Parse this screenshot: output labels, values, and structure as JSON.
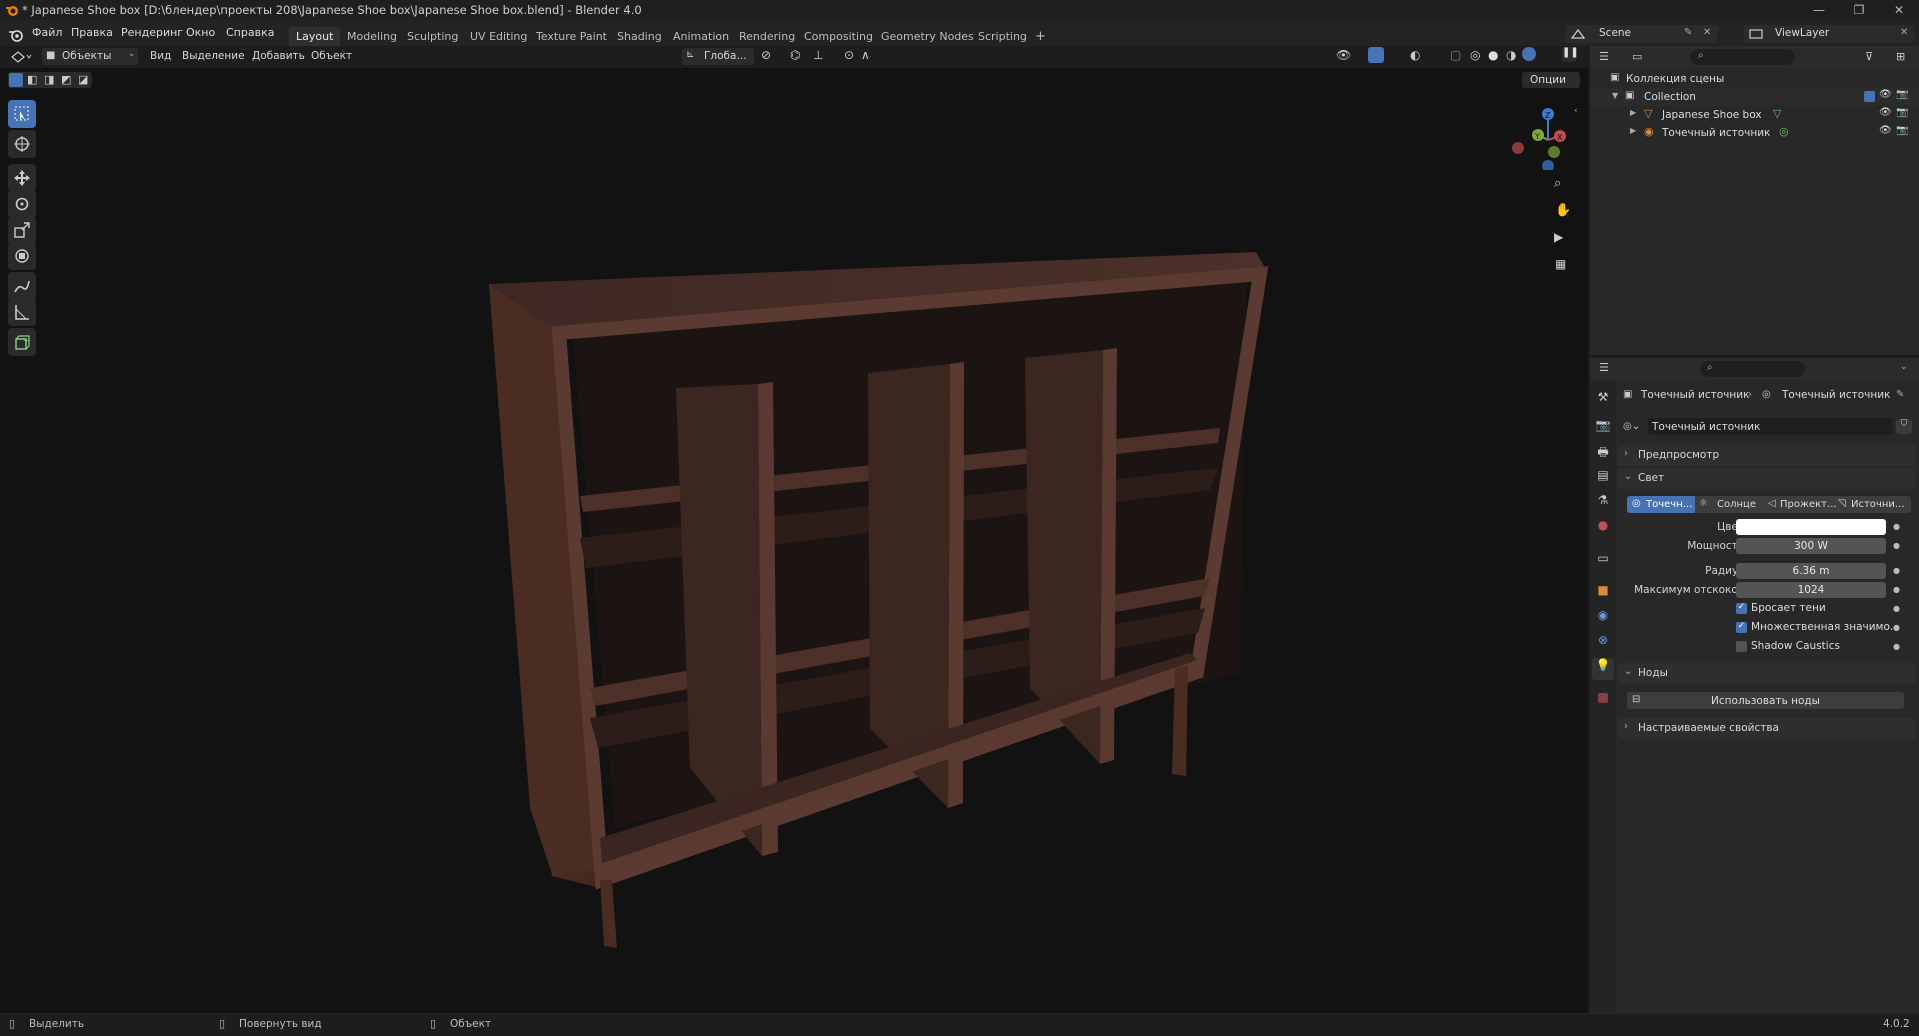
{
  "window": {
    "title": "* Japanese Shoe box [D:\\блендер\\проекты 208\\Japanese Shoe box\\Japanese Shoe box.blend] - Blender 4.0"
  },
  "menu": {
    "items": [
      "Файл",
      "Правка",
      "Рендеринг",
      "Окно",
      "Справка"
    ]
  },
  "workspaces": {
    "tabs": [
      "Layout",
      "Modeling",
      "Sculpting",
      "UV Editing",
      "Texture Paint",
      "Shading",
      "Animation",
      "Rendering",
      "Compositing",
      "Geometry Nodes",
      "Scripting"
    ],
    "add": "+",
    "active": "Layout"
  },
  "scene": {
    "label": "Scene",
    "viewlayer": "ViewLayer"
  },
  "viewport_header": {
    "mode": "Объекты",
    "menus": [
      "Вид",
      "Выделение",
      "Добавить",
      "Объект"
    ],
    "orientation": "Глоба...",
    "options": "Опции"
  },
  "gizmo": {
    "x": "X",
    "y": "Y",
    "z": "Z"
  },
  "outliner": {
    "root": "Коллекция сцены",
    "collection": "Collection",
    "items": [
      "Japanese Shoe box",
      "Точечный источник"
    ]
  },
  "properties": {
    "breadcrumb_object": "Точечный источник",
    "breadcrumb_data": "Точечный источник",
    "datablock": "Точечный источник",
    "sections": {
      "preview": "Предпросмотр",
      "light": "Свет",
      "nodes": "Ноды",
      "custom": "Настраиваемые свойства"
    },
    "light_types": [
      "Точечн...",
      "Солнце",
      "Прожект...",
      "Источни..."
    ],
    "fields": {
      "color_label": "Цвет",
      "power_label": "Мощность",
      "power_value": "300 W",
      "radius_label": "Радиус",
      "radius_value": "6.36 m",
      "bounces_label": "Максимум отскоков",
      "bounces_value": "1024"
    },
    "checkboxes": [
      {
        "label": "Бросает тени",
        "checked": true
      },
      {
        "label": "Множественная значимо...",
        "checked": true
      },
      {
        "label": "Shadow Caustics",
        "checked": false
      }
    ],
    "use_nodes": "Использовать ноды"
  },
  "statusbar": {
    "select": "Выделить",
    "rotate": "Повернуть вид",
    "object": "Объект",
    "version": "4.0.2"
  },
  "colors": {
    "accent": "#4772b3",
    "wood": "#4a2e28",
    "background": "#121212"
  }
}
